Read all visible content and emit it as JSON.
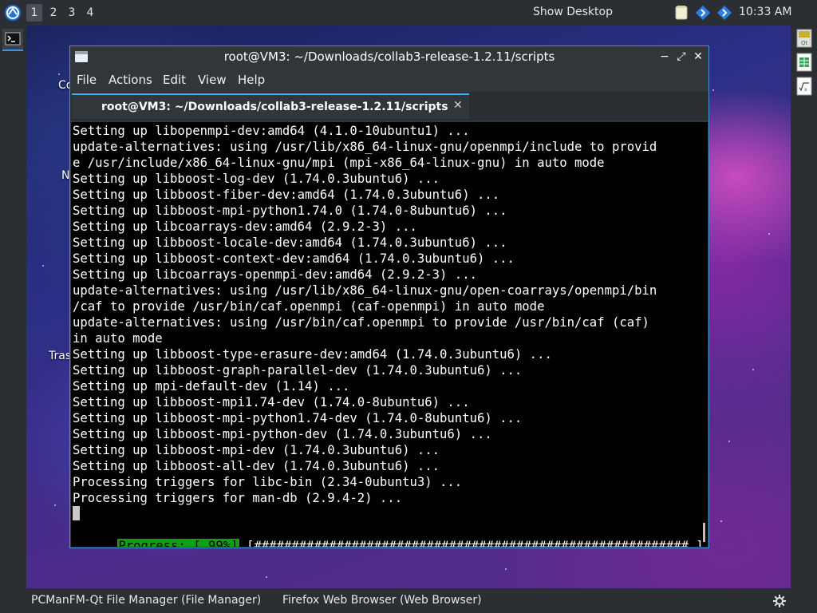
{
  "panel": {
    "workspaces": [
      "1",
      "2",
      "3",
      "4"
    ],
    "active_workspace": "1",
    "show_desktop": "Show Desktop",
    "clock": "10:33 AM"
  },
  "desktop": {
    "labels": [
      "Co",
      "N",
      "Tras"
    ]
  },
  "window": {
    "title": "root@VM3: ~/Downloads/collab3-release-1.2.11/scripts",
    "buttons": {
      "minimize": "−",
      "maximize": "⤢",
      "close": "✕"
    },
    "menu": [
      "File",
      "Actions",
      "Edit",
      "View",
      "Help"
    ],
    "tab": {
      "label": "root@VM3: ~/Downloads/collab3-release-1.2.11/scripts",
      "close": "✕"
    }
  },
  "terminal": {
    "lines": [
      "Setting up libopenmpi-dev:amd64 (4.1.0-10ubuntu1) ...",
      "update-alternatives: using /usr/lib/x86_64-linux-gnu/openmpi/include to provid",
      "e /usr/include/x86_64-linux-gnu/mpi (mpi-x86_64-linux-gnu) in auto mode",
      "Setting up libboost-log-dev (1.74.0.3ubuntu6) ...",
      "Setting up libboost-fiber-dev:amd64 (1.74.0.3ubuntu6) ...",
      "Setting up libboost-mpi-python1.74.0 (1.74.0-8ubuntu6) ...",
      "Setting up libcoarrays-dev:amd64 (2.9.2-3) ...",
      "Setting up libboost-locale-dev:amd64 (1.74.0.3ubuntu6) ...",
      "Setting up libboost-context-dev:amd64 (1.74.0.3ubuntu6) ...",
      "Setting up libcoarrays-openmpi-dev:amd64 (2.9.2-3) ...",
      "update-alternatives: using /usr/lib/x86_64-linux-gnu/open-coarrays/openmpi/bin",
      "/caf to provide /usr/bin/caf.openmpi (caf-openmpi) in auto mode",
      "update-alternatives: using /usr/bin/caf.openmpi to provide /usr/bin/caf (caf)",
      "in auto mode",
      "Setting up libboost-type-erasure-dev:amd64 (1.74.0.3ubuntu6) ...",
      "Setting up libboost-graph-parallel-dev (1.74.0.3ubuntu6) ...",
      "Setting up mpi-default-dev (1.14) ...",
      "Setting up libboost-mpi1.74-dev (1.74.0-8ubuntu6) ...",
      "Setting up libboost-mpi-python1.74-dev (1.74.0-8ubuntu6) ...",
      "Setting up libboost-mpi-python-dev (1.74.0.3ubuntu6) ...",
      "Setting up libboost-mpi-dev (1.74.0.3ubuntu6) ...",
      "Setting up libboost-all-dev (1.74.0.3ubuntu6) ...",
      "Processing triggers for libc-bin (2.34-0ubuntu3) ...",
      "Processing triggers for man-db (2.9.4-2) ..."
    ],
    "progress_label": "Progress: [ 99%]",
    "progress_bar": "[##########################################################.]",
    "progress_value": 0.99
  },
  "taskbar": {
    "tasks": [
      "PCManFM-Qt File Manager (File Manager)",
      "Firefox Web Browser (Web Browser)"
    ]
  },
  "icons": {
    "start": "lubuntu-logo-icon",
    "notes": "notes-icon",
    "network": "network-diamond-icon",
    "dock_terminal": "terminal-icon",
    "dock_right": [
      "qt-icon",
      "spreadsheet-icon",
      "math-formula-icon"
    ],
    "settings": "gear-icon"
  },
  "colors": {
    "accent": "#3daee9",
    "progress": "#10a010",
    "terminal_bg": "#000000",
    "panel_bg": "#2b2f33"
  }
}
